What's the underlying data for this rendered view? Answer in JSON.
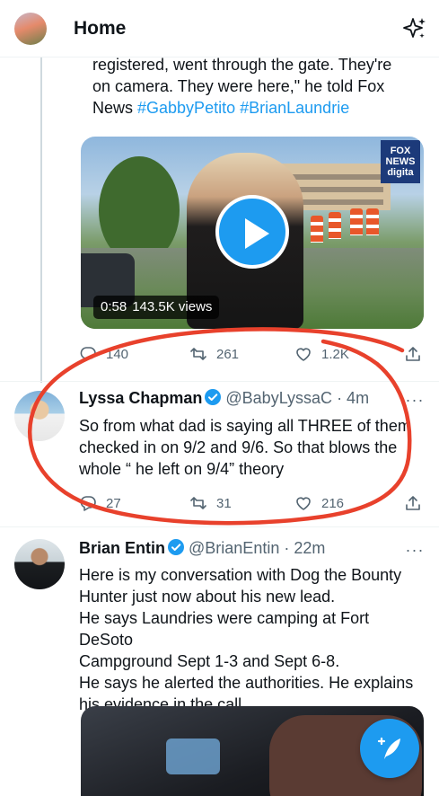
{
  "header": {
    "title": "Home",
    "avatar_icon": "profile-avatar",
    "right_icon": "sparkle-icon"
  },
  "tweet1": {
    "text_line1": "registered, went through the gate. They're",
    "text_line2": "on camera. They were here,\" he told Fox",
    "text_line3_prefix": "News ",
    "hashtag1": "#GabbyPetito",
    "hashtag2": "#BrianLaundrie",
    "video": {
      "duration": "0:58",
      "views": "143.5K views",
      "logo_text": "FOX NEWS digita"
    },
    "actions": {
      "replies": "140",
      "retweets": "261",
      "likes": "1.2K"
    }
  },
  "tweet2": {
    "name": "Lyssa Chapman",
    "handle": "@BabyLyssaC",
    "time": "· 4m",
    "line1": "So from what dad is saying all THREE of them",
    "line2": "checked in on 9/2 and 9/6. So that blows the",
    "line3": "whole “ he left on 9/4” theory",
    "actions": {
      "replies": "27",
      "retweets": "31",
      "likes": "216"
    }
  },
  "tweet3": {
    "name": "Brian Entin",
    "handle": "@BrianEntin",
    "time": "· 22m",
    "line1": "Here is my conversation with Dog the Bounty",
    "line2": "Hunter just now about his new lead.",
    "line3": "He says Laundries were camping at Fort DeSoto",
    "line4": "Campground  Sept 1-3 and Sept 6-8.",
    "line5": "He says he alerted the authorities. He explains",
    "line6": "his evidence in the call."
  },
  "colors": {
    "accent": "#1d9bf0",
    "annotation": "#e8412c",
    "secondary_text": "#536471"
  }
}
